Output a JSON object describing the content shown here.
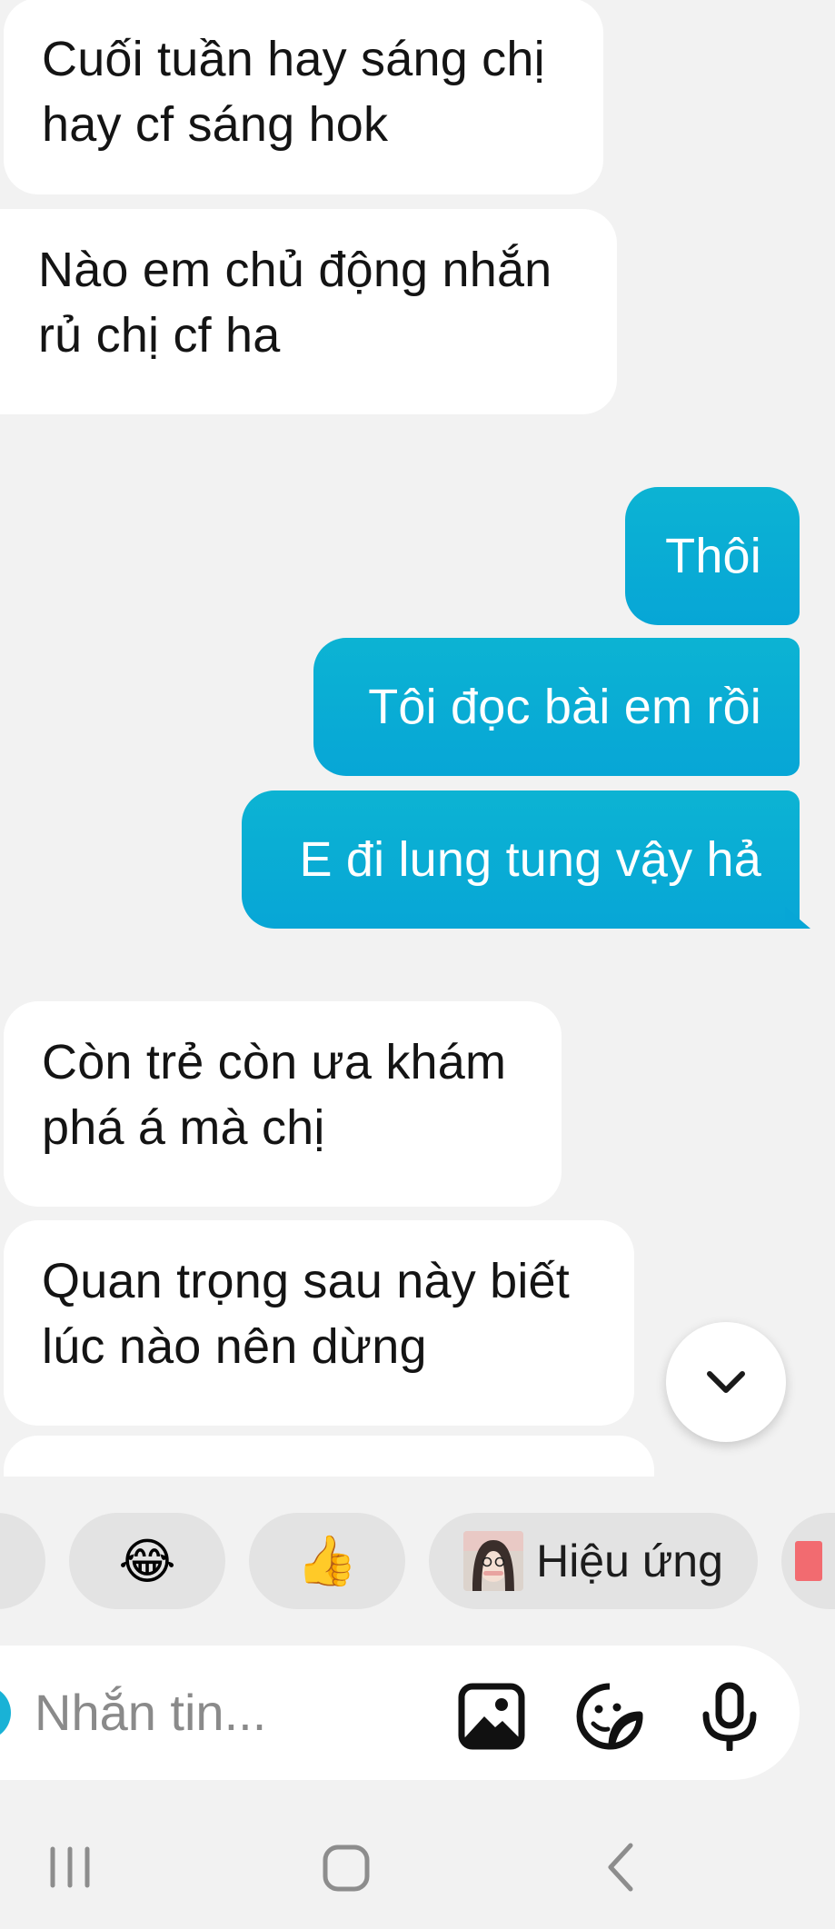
{
  "messages": [
    {
      "side": "in",
      "text_lines": [
        "Cuối tuần hay sáng chị",
        "hay cf sáng hok"
      ]
    },
    {
      "side": "in",
      "text_lines": [
        "Nào em chủ động nhắn",
        "rủ chị cf ha"
      ]
    },
    {
      "side": "out",
      "text": "Thôi"
    },
    {
      "side": "out",
      "text": "Tôi đọc bài em rồi"
    },
    {
      "side": "out",
      "text": "E đi lung tung vậy hả"
    },
    {
      "side": "in",
      "text_lines": [
        "Còn trẻ còn ưa khám",
        "phá á mà chị"
      ]
    },
    {
      "side": "in",
      "text_lines": [
        "Quan trọng sau này biết",
        "lúc nào nên dừng"
      ]
    }
  ],
  "scroll_down_icon": "chevron-down-icon",
  "reactions": {
    "items": [
      {
        "emoji": "😂",
        "icon": "laughing-emoji-icon"
      },
      {
        "emoji": "👍",
        "icon": "thumbs-up-emoji-icon"
      }
    ],
    "effects_label": "Hiệu ứng"
  },
  "composer": {
    "placeholder": "Nhắn tin...",
    "icons": [
      "image-icon",
      "sticker-icon",
      "microphone-icon"
    ]
  },
  "navbar": {
    "icons": [
      "recent-apps-icon",
      "home-icon",
      "back-icon"
    ]
  },
  "colors": {
    "outgoing_bubble": "#0bb0d6",
    "incoming_bubble": "#ffffff",
    "background": "#f2f2f2"
  }
}
